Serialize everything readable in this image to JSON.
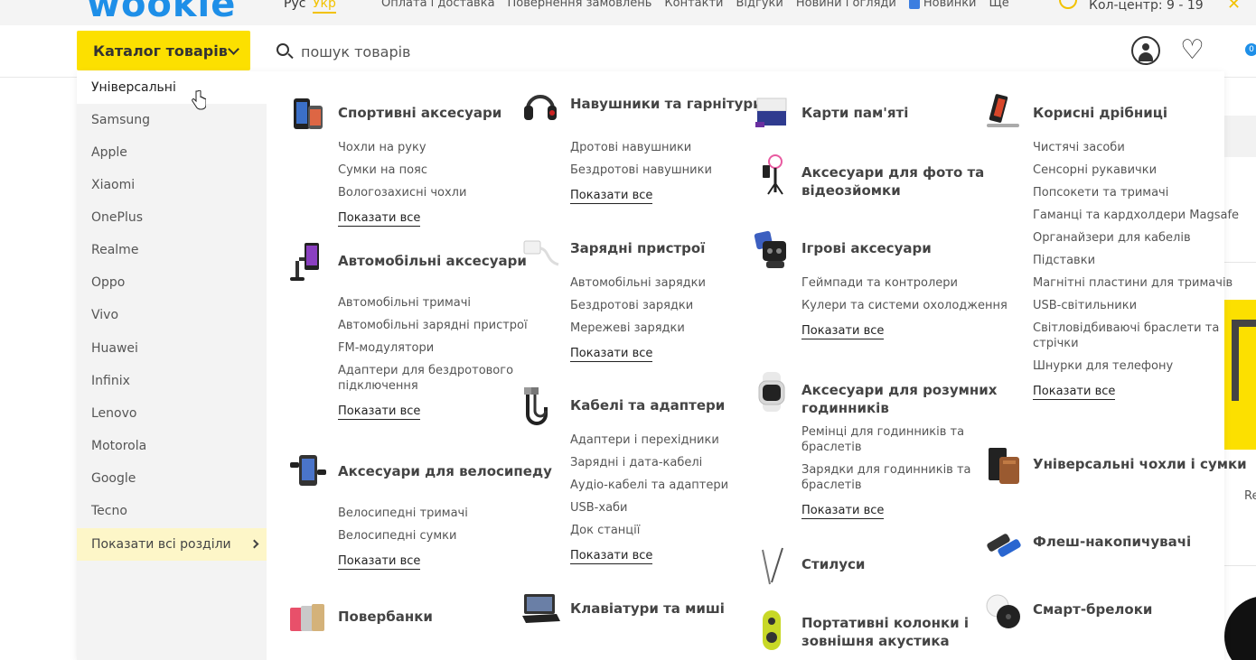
{
  "topbar": {
    "logo": "wookie",
    "lang_ru": "Рус",
    "lang_ua": "Укр",
    "nav": [
      "Оплата і доставка",
      "Повернення замовлень",
      "Контакти",
      "Відгуки",
      "Новини і огляди",
      "Новинки",
      "Ще"
    ],
    "call_center": "Кол-центр: 9 - 19"
  },
  "header": {
    "catalog_label": "Каталог товарів",
    "search_placeholder": "пошук товарів",
    "cart_count": "0"
  },
  "background": {
    "re_text": "Re"
  },
  "brands": [
    "Універсальні",
    "Samsung",
    "Apple",
    "Xiaomi",
    "OnePlus",
    "Realme",
    "Oppo",
    "Vivo",
    "Huawei",
    "Infinix",
    "Lenovo",
    "Motorola",
    "Google",
    "Tecno"
  ],
  "brands_show_all": "Показати всі розділи",
  "show_all_label": "Показати все",
  "categories": {
    "sport": {
      "title": "Спортивні аксесуари",
      "items": [
        "Чохли на руку",
        "Сумки на пояс",
        "Вологозахисні чохли"
      ]
    },
    "auto": {
      "title": "Автомобільні аксесуари",
      "items": [
        "Автомобільні тримачі",
        "Автомобільні зарядні пристрої",
        "FM-модулятори",
        "Адаптери для бездротового підключення"
      ]
    },
    "bike": {
      "title": "Аксесуари для велосипеду",
      "items": [
        "Велосипедні тримачі",
        "Велосипедні сумки"
      ]
    },
    "powerbank": {
      "title": "Повербанки",
      "items": []
    },
    "headphones": {
      "title": "Навушники та гарнітури",
      "items": [
        "Дротові навушники",
        "Бездротові навушники"
      ]
    },
    "chargers": {
      "title": "Зарядні пристрої",
      "items": [
        "Автомобільні зарядки",
        "Бездротові зарядки",
        "Мережеві зарядки"
      ]
    },
    "cables": {
      "title": "Кабелі та адаптери",
      "items": [
        "Адаптери і перехідники",
        "Зарядні і дата-кабелі",
        "Аудіо-кабелі та адаптери",
        "USB-хаби",
        "Док станції"
      ]
    },
    "keyboards": {
      "title": "Клавіатури та миші",
      "items": []
    },
    "memory": {
      "title": "Карти пам'яті",
      "items": []
    },
    "photo": {
      "title": "Аксесуари для фото та відеозйомки",
      "items": []
    },
    "gaming": {
      "title": "Ігрові аксесуари",
      "items": [
        "Геймпади та контролери",
        "Кулери та системи охолодження"
      ]
    },
    "watch": {
      "title": "Аксесуари для розумних годинників",
      "items": [
        "Ремінці для годинників та браслетів",
        "Зарядки для годинників та браслетів"
      ]
    },
    "stylus": {
      "title": "Стилуси",
      "items": []
    },
    "speakers": {
      "title": "Портативні колонки і зовнішня акустика",
      "items": []
    },
    "useful": {
      "title": "Корисні дрібниці",
      "items": [
        "Чистячі засоби",
        "Сенсорні рукавички",
        "Попсокети та тримачі",
        "Гаманці та кардхолдери Magsafe",
        "Органайзери для кабелів",
        "Підставки",
        "Магнітні пластини для тримачів",
        "USB-світильники",
        "Світловідбиваючі браслети та стрічки",
        "Шнурки для телефону"
      ]
    },
    "cases": {
      "title": "Універсальні чохли і сумки",
      "items": []
    },
    "flash": {
      "title": "Флеш-накопичувачі",
      "items": []
    },
    "trackers": {
      "title": "Смарт-брелоки",
      "items": []
    }
  }
}
